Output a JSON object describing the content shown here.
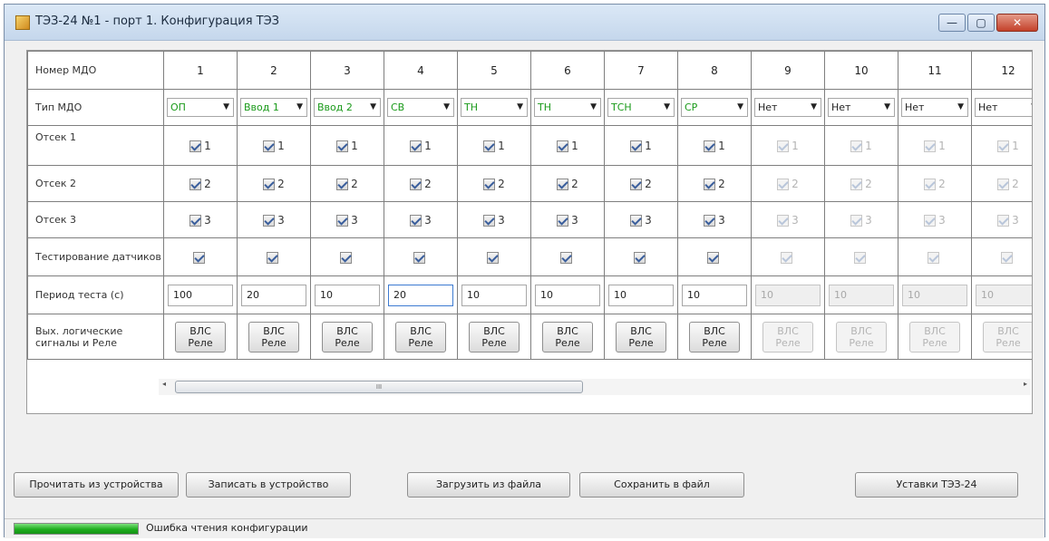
{
  "window": {
    "title": "ТЭЗ-24 №1 - порт 1. Конфигурация ТЭЗ",
    "min_label": "—",
    "max_label": "▢",
    "close_label": "✕"
  },
  "grid": {
    "row_labels": {
      "number": "Номер МДО",
      "type": "Тип МДО",
      "otsek1": "Отсек 1",
      "otsek2": "Отсек 2",
      "otsek3": "Отсек 3",
      "test": "Тестирование датчиков",
      "period": "Период теста (с)",
      "outputs": "Вых. логические сигналы и Реле"
    },
    "columns": [
      {
        "num": "1",
        "type": "ОП",
        "type_color": "green",
        "period": "100",
        "enabled": true
      },
      {
        "num": "2",
        "type": "Ввод 1",
        "type_color": "green",
        "period": "20",
        "enabled": true
      },
      {
        "num": "3",
        "type": "Ввод 2",
        "type_color": "green",
        "period": "10",
        "enabled": true
      },
      {
        "num": "4",
        "type": "СВ",
        "type_color": "green",
        "period": "20",
        "enabled": true,
        "focused": true
      },
      {
        "num": "5",
        "type": "ТН",
        "type_color": "green",
        "period": "10",
        "enabled": true
      },
      {
        "num": "6",
        "type": "ТН",
        "type_color": "green",
        "period": "10",
        "enabled": true
      },
      {
        "num": "7",
        "type": "ТСН",
        "type_color": "green",
        "period": "10",
        "enabled": true
      },
      {
        "num": "8",
        "type": "СР",
        "type_color": "green",
        "period": "10",
        "enabled": true
      },
      {
        "num": "9",
        "type": "Нет",
        "type_color": "black",
        "period": "10",
        "enabled": false
      },
      {
        "num": "10",
        "type": "Нет",
        "type_color": "black",
        "period": "10",
        "enabled": false
      },
      {
        "num": "11",
        "type": "Нет",
        "type_color": "black",
        "period": "10",
        "enabled": false
      },
      {
        "num": "12",
        "type": "Нет",
        "type_color": "black",
        "period": "10",
        "enabled": false
      }
    ],
    "checkbox_labels": [
      "1",
      "2",
      "3"
    ],
    "signal_button": {
      "line1": "ВЛС",
      "line2": "Реле"
    }
  },
  "scrollbar": {
    "left_arrow": "◂",
    "right_arrow": "▸",
    "thumb_grip": "III"
  },
  "buttons": {
    "read": "Прочитать из устройства",
    "write": "Записать в устройство",
    "load": "Загрузить из файла",
    "save": "Сохранить в файл",
    "settings": "Уставки ТЭЗ-24"
  },
  "status": {
    "text": "Ошибка чтения конфигурации",
    "progress": 1.0
  },
  "colors": {
    "type_green": "#1a9a1a",
    "progress_green": "#1fae1f",
    "title_bar": "#c5d7ec"
  }
}
